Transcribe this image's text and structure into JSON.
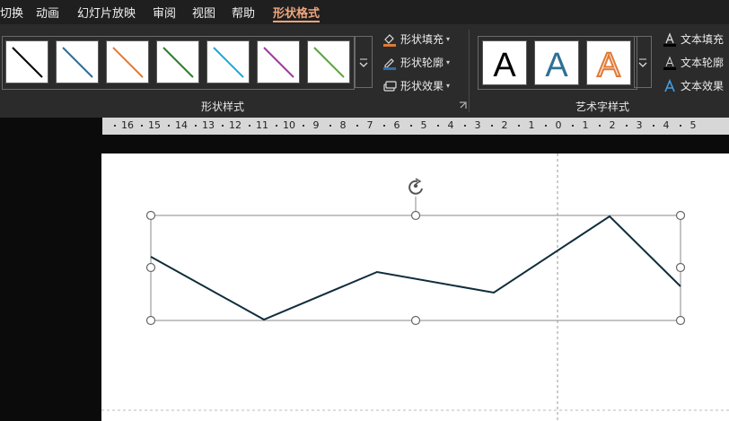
{
  "menu": {
    "items": [
      "切换",
      "动画",
      "幻灯片放映",
      "审阅",
      "视图",
      "帮助",
      "形状格式"
    ],
    "active": "形状格式"
  },
  "ribbon": {
    "shape_styles": {
      "group_label": "形状样式",
      "swatch_colors": [
        "#000000",
        "#2e6f96",
        "#e07a35",
        "#2e7d32",
        "#1ea7d6",
        "#9c3e9e",
        "#5aa43c"
      ],
      "fill_label": "形状填充",
      "outline_label": "形状轮廓",
      "effects_label": "形状效果"
    },
    "wordart": {
      "group_label": "艺术字样式",
      "letters": [
        "A",
        "A",
        "A"
      ],
      "text_fill_label": "文本填充",
      "text_outline_label": "文本轮廓",
      "text_effects_label": "文本效果"
    }
  },
  "ruler": {
    "labels": [
      "16",
      "15",
      "14",
      "13",
      "12",
      "11",
      "10",
      "9",
      "8",
      "7",
      "6",
      "5",
      "4",
      "3",
      "2",
      "1",
      "0",
      "1",
      "2",
      "3",
      "4",
      "5"
    ]
  },
  "shape": {
    "type": "freeform polyline",
    "stroke_color": "#0f2d3d"
  },
  "colors": {
    "accent": "#f0a67e",
    "ribbon_bg": "#2b2b2b"
  }
}
